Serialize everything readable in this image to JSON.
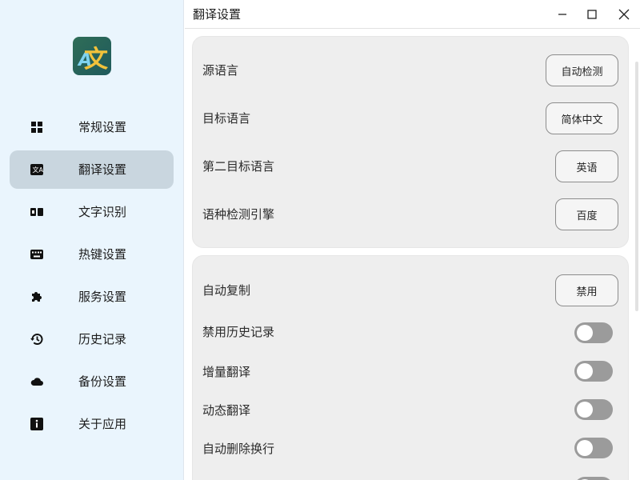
{
  "window": {
    "title": "翻译设置"
  },
  "sidebar": {
    "items": [
      {
        "label": "常规设置",
        "icon": "grid-icon"
      },
      {
        "label": "翻译设置",
        "icon": "translate-icon",
        "active": true
      },
      {
        "label": "文字识别",
        "icon": "ocr-icon"
      },
      {
        "label": "热键设置",
        "icon": "keyboard-icon"
      },
      {
        "label": "服务设置",
        "icon": "puzzle-icon"
      },
      {
        "label": "历史记录",
        "icon": "history-icon"
      },
      {
        "label": "备份设置",
        "icon": "cloud-icon"
      },
      {
        "label": "关于应用",
        "icon": "info-icon"
      }
    ]
  },
  "language_card": {
    "source": {
      "label": "源语言",
      "value": "自动检测"
    },
    "target": {
      "label": "目标语言",
      "value": "简体中文"
    },
    "second_target": {
      "label": "第二目标语言",
      "value": "英语"
    },
    "detect_engine": {
      "label": "语种检测引擎",
      "value": "百度"
    }
  },
  "options_card": {
    "auto_copy": {
      "label": "自动复制",
      "value": "禁用"
    },
    "disable_history": {
      "label": "禁用历史记录",
      "enabled": false
    },
    "incremental": {
      "label": "增量翻译",
      "enabled": false
    },
    "dynamic": {
      "label": "动态翻译",
      "enabled": false
    },
    "auto_remove_newline": {
      "label": "自动删除换行",
      "enabled": false
    }
  },
  "colors": {
    "sidebar_bg": "#eaf5fd",
    "active_item": "#c9d6df",
    "card_bg": "#eeeeee",
    "toggle_off": "#9b9b9b"
  }
}
